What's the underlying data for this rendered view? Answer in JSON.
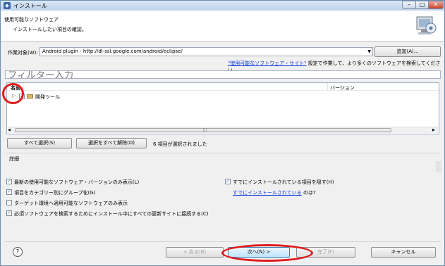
{
  "window": {
    "title": "インストール",
    "icon": "eclipse-install-icon"
  },
  "banner": {
    "title": "使用可能なソフトウェア",
    "subtitle": "インストールしたい項目の確認。",
    "icon": "install-wizard-icon"
  },
  "work_with": {
    "label": "作業対象(W):",
    "value": "Android plugin - http://dl-ssl.google.com/android/eclipse/",
    "add_label": "追加(A)..."
  },
  "sites_hint": {
    "link": "\"使用可能なソフトウェア・サイト\"",
    "text": " 設定で作業して、より多くのソフトウェアを検索してください。"
  },
  "filter": {
    "placeholder": "フィルター入力"
  },
  "table": {
    "columns": [
      "名前",
      "バージョン"
    ],
    "rows": [
      {
        "name": "開発ツール",
        "version": "",
        "checked": true,
        "expanded": false
      }
    ]
  },
  "selection": {
    "select_all": "すべて選択(S)",
    "deselect_all": "選択をすべて解除(D)",
    "count_text": "6 項目が選択されました"
  },
  "details": {
    "label": "詳細"
  },
  "options": {
    "latest": {
      "label": "最新の使用可能なソフトウェア・バージョンのみ表示(L)",
      "checked": true
    },
    "group": {
      "label": "項目をカテゴリー別にグループ化(G)",
      "checked": true
    },
    "target": {
      "label": "ターゲット環境へ適用可能なソフトウェアのみ表示",
      "checked": false
    },
    "contact": {
      "label": "必須ソフトウェアを検索するためにインストール中にすべての更新サイトに接続する(C)",
      "checked": true
    },
    "hide": {
      "label": "すでにインストールされている項目を隠す(H)",
      "checked": true
    }
  },
  "installed_hint": {
    "link": "すでにインストールされている",
    "text": " のは?"
  },
  "footer": {
    "help_icon": "help-icon",
    "back": "< 戻る(B)",
    "next": "次へ(N) >",
    "finish": "完了(F)",
    "cancel": "キャンセル"
  },
  "annotation_color": "#e01b1b"
}
